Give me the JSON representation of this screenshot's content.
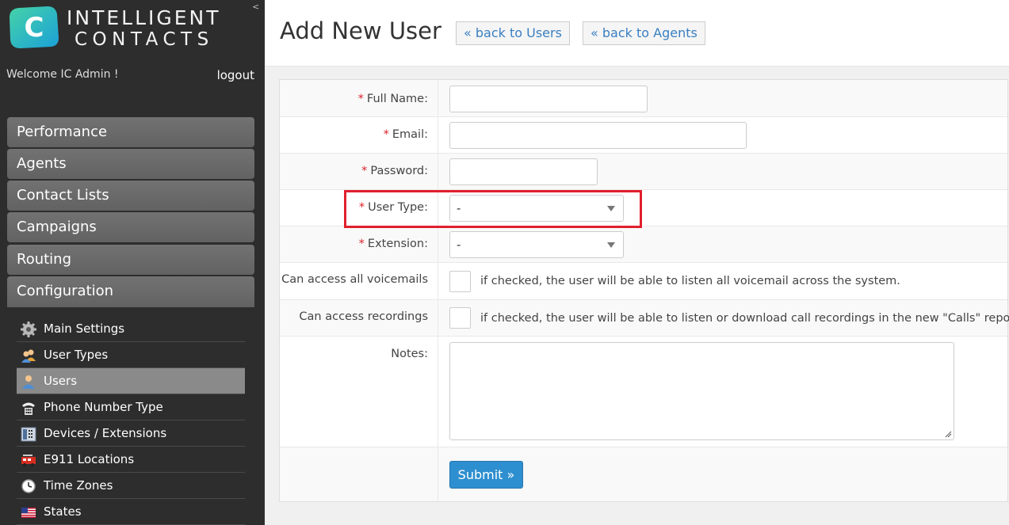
{
  "sidebar": {
    "logo": {
      "line1": "INTELLIGENT",
      "line2": "CONTACTS",
      "mark": "C"
    },
    "collapse_icon": "<",
    "welcome": "Welcome IC Admin !",
    "logout": "logout",
    "nav": [
      {
        "label": "Performance"
      },
      {
        "label": "Agents"
      },
      {
        "label": "Contact Lists"
      },
      {
        "label": "Campaigns"
      },
      {
        "label": "Routing"
      },
      {
        "label": "Configuration"
      }
    ],
    "submenu": [
      {
        "label": "Main Settings",
        "icon": "gear-icon"
      },
      {
        "label": "User Types",
        "icon": "user-types-icon"
      },
      {
        "label": "Users",
        "icon": "user-icon",
        "active": true
      },
      {
        "label": "Phone Number Type",
        "icon": "phone-icon"
      },
      {
        "label": "Devices / Extensions",
        "icon": "device-icon"
      },
      {
        "label": "E911 Locations",
        "icon": "fire-truck-icon"
      },
      {
        "label": "Time Zones",
        "icon": "clock-icon"
      },
      {
        "label": "States",
        "icon": "us-flag-icon"
      }
    ]
  },
  "header": {
    "title": "Add New User",
    "back_users": "« back to Users",
    "back_agents": "« back to Agents"
  },
  "form": {
    "required_mark": "*",
    "full_name_label": "Full Name:",
    "email_label": "Email:",
    "password_label": "Password:",
    "user_type_label": "User Type:",
    "user_type_value": "-",
    "extension_label": "Extension:",
    "extension_value": "-",
    "voicemail_label": "Can access all voicemails",
    "voicemail_help": "if checked, the user will be able to listen all voicemail across the system.",
    "recordings_label": "Can access recordings",
    "recordings_help": "if checked, the user will be able to listen or download call recordings in the new \"Calls\" report.",
    "notes_label": "Notes:",
    "submit": "Submit »"
  },
  "colors": {
    "sidebar_bg": "#2d2d2d",
    "nav_button": "#6a6a6a",
    "active_submenu": "#8a8a8a",
    "required": "#d9202a",
    "link": "#3a7fc1",
    "submit_bg": "#2e8fd0",
    "highlight": "#e11f2d"
  }
}
